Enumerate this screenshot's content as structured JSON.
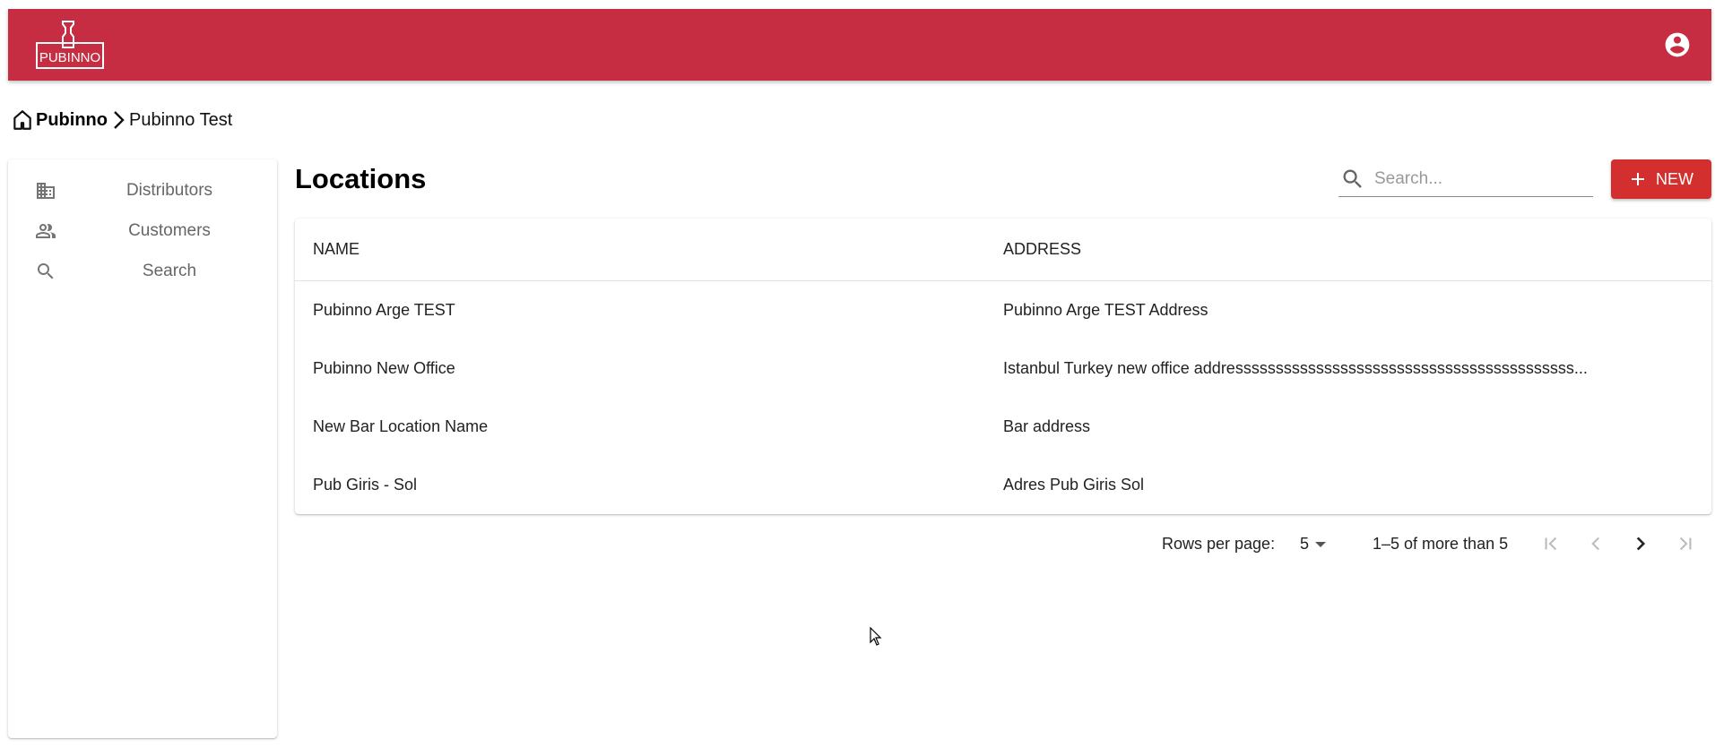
{
  "appbar": {
    "brand_color": "#c62d42",
    "logo_text": "PUBINNO",
    "account_icon": "account-circle-icon"
  },
  "breadcrumb": {
    "root": "Pubinno",
    "current": "Pubinno Test",
    "home_icon": "home-icon",
    "separator_icon": "chevron-right-icon"
  },
  "sidebar": {
    "items": [
      {
        "label": "Distributors",
        "icon": "business-icon"
      },
      {
        "label": "Customers",
        "icon": "people-icon"
      },
      {
        "label": "Search",
        "icon": "search-icon"
      }
    ]
  },
  "page": {
    "title": "Locations"
  },
  "search": {
    "placeholder": "Search...",
    "value": ""
  },
  "toolbar": {
    "new_label": "NEW",
    "accent_color": "#d32f2f"
  },
  "table": {
    "columns": [
      "NAME",
      "ADDRESS"
    ],
    "rows": [
      {
        "name": "Pubinno Arge TEST",
        "address": "Pubinno Arge TEST Address"
      },
      {
        "name": "Pubinno New Office",
        "address": "Istanbul Turkey new office addressssssssssssssssssssssssssssssssssssssssss..."
      },
      {
        "name": "New Bar Location Name",
        "address": "Bar address"
      },
      {
        "name": "Pub Giris - Sol",
        "address": "Adres Pub Giris Sol"
      }
    ]
  },
  "pagination": {
    "rows_per_page_label": "Rows per page:",
    "rows_per_page_value": "5",
    "range_text": "1–5 of more than 5"
  }
}
